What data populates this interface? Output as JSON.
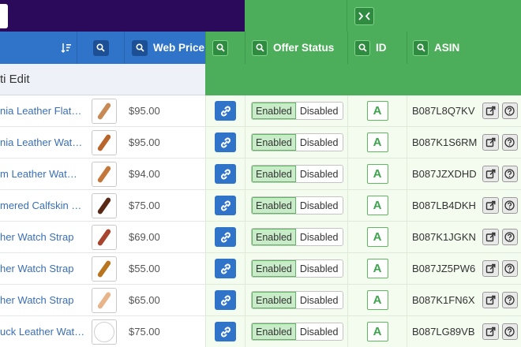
{
  "header": {
    "web_price": "Web Price",
    "offer_status": "Offer Status",
    "id": "ID",
    "asin": "ASIN"
  },
  "multi_edit": "ti Edit",
  "rows": [
    {
      "title": "nia Leather Flat…",
      "price": "$95.00",
      "status_on": "Enabled",
      "status_off": "Disabled",
      "id": "A",
      "asin": "B087L8Q7KV",
      "strap": "#c88a55"
    },
    {
      "title": "nia Leather Wat…",
      "price": "$95.00",
      "status_on": "Enabled",
      "status_off": "Disabled",
      "id": "A",
      "asin": "B087K1S6RM",
      "strap": "#b8642a"
    },
    {
      "title": "m Leather Wat…",
      "price": "$94.00",
      "status_on": "Enabled",
      "status_off": "Disabled",
      "id": "A",
      "asin": "B087JZXDHD",
      "strap": "#c4773b"
    },
    {
      "title": "mered Calfskin …",
      "price": "$75.00",
      "status_on": "Enabled",
      "status_off": "Disabled",
      "id": "A",
      "asin": "B087LB4DKH",
      "strap": "#5a2a18"
    },
    {
      "title": "her Watch Strap",
      "price": "$69.00",
      "status_on": "Enabled",
      "status_off": "Disabled",
      "id": "A",
      "asin": "B087K1JGKN",
      "strap": "#a8452e"
    },
    {
      "title": "her Watch Strap",
      "price": "$55.00",
      "status_on": "Enabled",
      "status_off": "Disabled",
      "id": "A",
      "asin": "B087JZ5PW6",
      "strap": "#b8741e"
    },
    {
      "title": "her Watch Strap",
      "price": "$65.00",
      "status_on": "Enabled",
      "status_off": "Disabled",
      "id": "A",
      "asin": "B087K1FN6X",
      "strap": "#e8b48a"
    },
    {
      "title": "uck Leather Wat…",
      "price": "$75.00",
      "status_on": "Enabled",
      "status_off": "Disabled",
      "id": "A",
      "asin": "B087LG89VB",
      "strap": "none"
    }
  ]
}
